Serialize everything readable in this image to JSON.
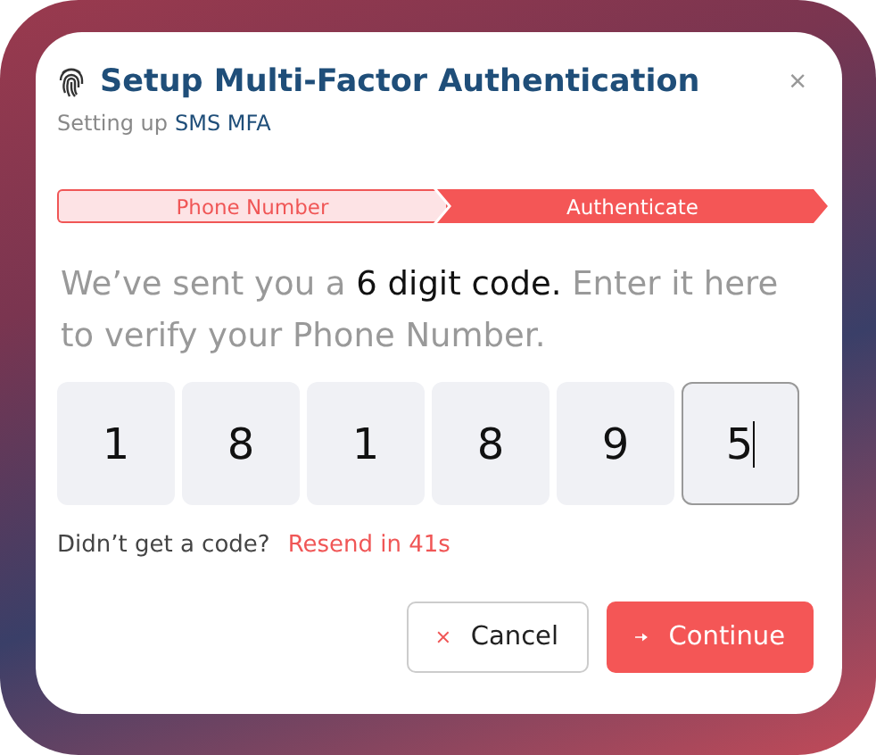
{
  "dialog": {
    "title": "Setup Multi-Factor Authentication",
    "close": "×",
    "subtitle": "Setting up",
    "method": "SMS MFA"
  },
  "steps": [
    {
      "label": "Phone Number",
      "selected": false
    },
    {
      "label": "Authenticate",
      "selected": true
    }
  ],
  "intro": "We’ve sent you a **6 digit code.** Enter it here to verify your Phone Number.",
  "code": [
    {
      "digit": "1",
      "focused": false
    },
    {
      "digit": "8",
      "focused": false
    },
    {
      "digit": "1",
      "focused": false
    },
    {
      "digit": "8",
      "focused": false
    },
    {
      "digit": "9",
      "focused": false
    },
    {
      "digit": "5",
      "focused": true
    }
  ],
  "resend": {
    "prompt": "Didn’t get a code?",
    "link": "Resend in 41s"
  },
  "buttons": [
    {
      "kind": "cancel",
      "label": "Cancel"
    },
    {
      "kind": "continue",
      "label": "Continue"
    }
  ]
}
